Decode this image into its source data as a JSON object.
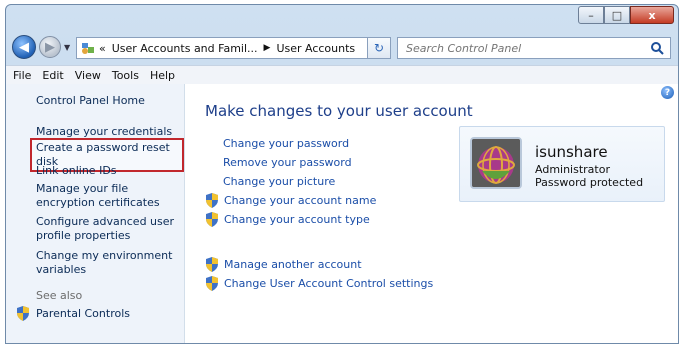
{
  "window": {
    "controls": {
      "minimize": "–",
      "maximize": "□",
      "close": "x"
    }
  },
  "address": {
    "overflow": "«",
    "crumbs": [
      "User Accounts and Famil...",
      "User Accounts"
    ],
    "search_placeholder": "Search Control Panel"
  },
  "menu": [
    "File",
    "Edit",
    "View",
    "Tools",
    "Help"
  ],
  "sidebar": {
    "home": "Control Panel Home",
    "links": [
      "Manage your credentials",
      "Create a password reset disk",
      "Link online IDs",
      "Manage your file encryption certificates",
      "Configure advanced user profile properties",
      "Change my environment variables"
    ],
    "see_also": "See also",
    "parental": "Parental Controls"
  },
  "main": {
    "heading": "Make changes to your user account",
    "tasks": [
      "Change your password",
      "Remove your password",
      "Change your picture",
      "Change your account name",
      "Change your account type"
    ],
    "other_tasks": [
      "Manage another account",
      "Change User Account Control settings"
    ]
  },
  "user": {
    "name": "isunshare",
    "role": "Administrator",
    "status": "Password protected"
  },
  "colors": {
    "link": "#1b4ea8",
    "heading": "#1e3f8a",
    "highlight_border": "#c1272d"
  },
  "icons": [
    "back-arrow-icon",
    "forward-arrow-icon",
    "control-panel-icon",
    "refresh-icon",
    "search-icon",
    "help-icon",
    "uac-shield-icon"
  ]
}
